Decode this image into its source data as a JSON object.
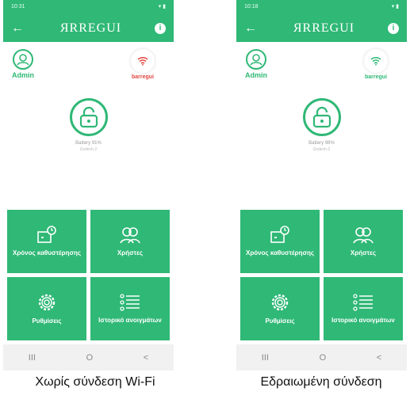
{
  "colors": {
    "accent": "#2fb876",
    "wifi_off": "#e2463f",
    "wifi_on": "#2fb876"
  },
  "brand": "ЯRREGUI",
  "phones": [
    {
      "status_time": "10:31",
      "admin_label": "Admin",
      "wifi_label": "barregui",
      "battery": "Battery 91%",
      "device": "Ωvdevh-2",
      "tiles": [
        "Χρόνος καθυστέρησης",
        "Χρήστες",
        "Ρυθμίσεις",
        "Ιστορικό ανοιγμάτων"
      ],
      "nav": [
        "III",
        "O",
        "<"
      ],
      "caption": "Χωρίς σύνδεση Wi-Fi"
    },
    {
      "status_time": "10:18",
      "admin_label": "Admin",
      "wifi_label": "barregui",
      "battery": "Battery 98%",
      "device": "Ωvdevh-2",
      "tiles": [
        "Χρόνος καθυστέρησης",
        "Χρήστες",
        "Ρυθμίσεις",
        "Ιστορικό ανοιγμάτων"
      ],
      "nav": [
        "III",
        "O",
        "<"
      ],
      "caption": "Εδραιωμένη σύνδεση"
    }
  ]
}
